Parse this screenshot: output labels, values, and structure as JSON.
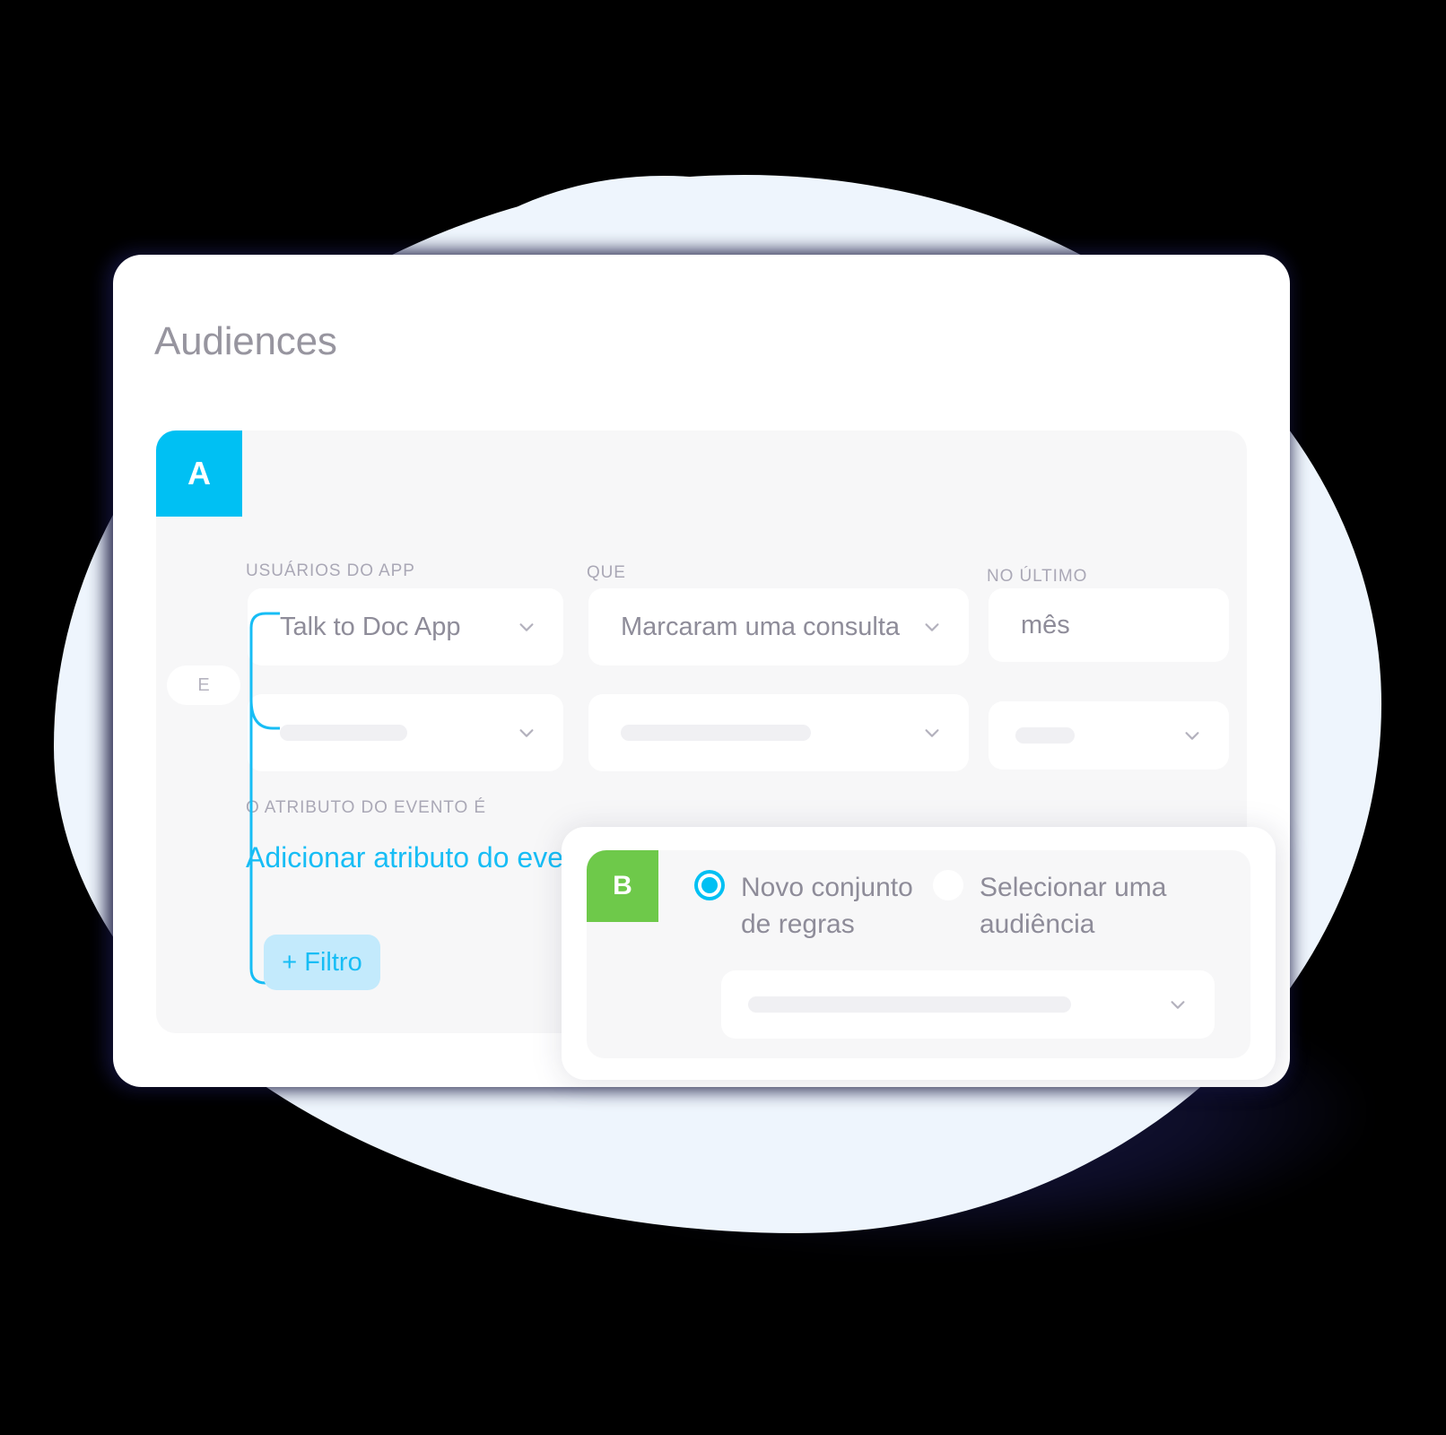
{
  "page": {
    "title": "Audiences"
  },
  "colors": {
    "accent_cyan": "#00c0f3",
    "accent_green": "#6ec94a",
    "link_blue": "#17bdf5",
    "filter_button_bg": "#c3eafc",
    "panel_bg": "#f7f7f8",
    "card_bg": "#ffffff",
    "backdrop_blob": "#eef5fd",
    "text_muted": "#8e8c99",
    "label_muted": "#aaa8b6"
  },
  "panel_a": {
    "badge": "A",
    "options": [
      {
        "label": "Novo conjunto de regras",
        "selected": true
      },
      {
        "label": "Selecionar uma audiência",
        "selected": false
      }
    ],
    "columns": [
      {
        "label": "USUÁRIOS DO APP"
      },
      {
        "label": "QUE"
      },
      {
        "label": "NO ÚLTIMO"
      }
    ],
    "row1": [
      {
        "value": "Talk to Doc App",
        "has_chevron": true
      },
      {
        "value": "Marcaram uma consulta",
        "has_chevron": true
      },
      {
        "value": "mês",
        "has_chevron": false
      }
    ],
    "row2": [
      {
        "value": "",
        "placeholder_width": 142,
        "has_chevron": true
      },
      {
        "value": "",
        "placeholder_width": 212,
        "has_chevron": true
      },
      {
        "value": "",
        "placeholder_width": 66,
        "has_chevron": true
      }
    ],
    "attribute_label": "O ATRIBUTO DO EVENTO É",
    "attribute_link": "Adicionar atributo do evento",
    "connector_operator": "E",
    "add_filter_button": "+ Filtro"
  },
  "panel_b": {
    "badge": "B",
    "options": [
      {
        "label": "Novo conjunto de regras",
        "selected": true
      },
      {
        "label": "Selecionar uma audiência",
        "selected": false
      }
    ],
    "select": {
      "value": "",
      "placeholder_width": 360,
      "has_chevron": true
    }
  },
  "icons": {
    "chevron_down": "chevron-down-icon",
    "radio_selected": "radio-selected-icon",
    "radio_unselected": "radio-unselected-icon",
    "plus": "plus-icon"
  }
}
